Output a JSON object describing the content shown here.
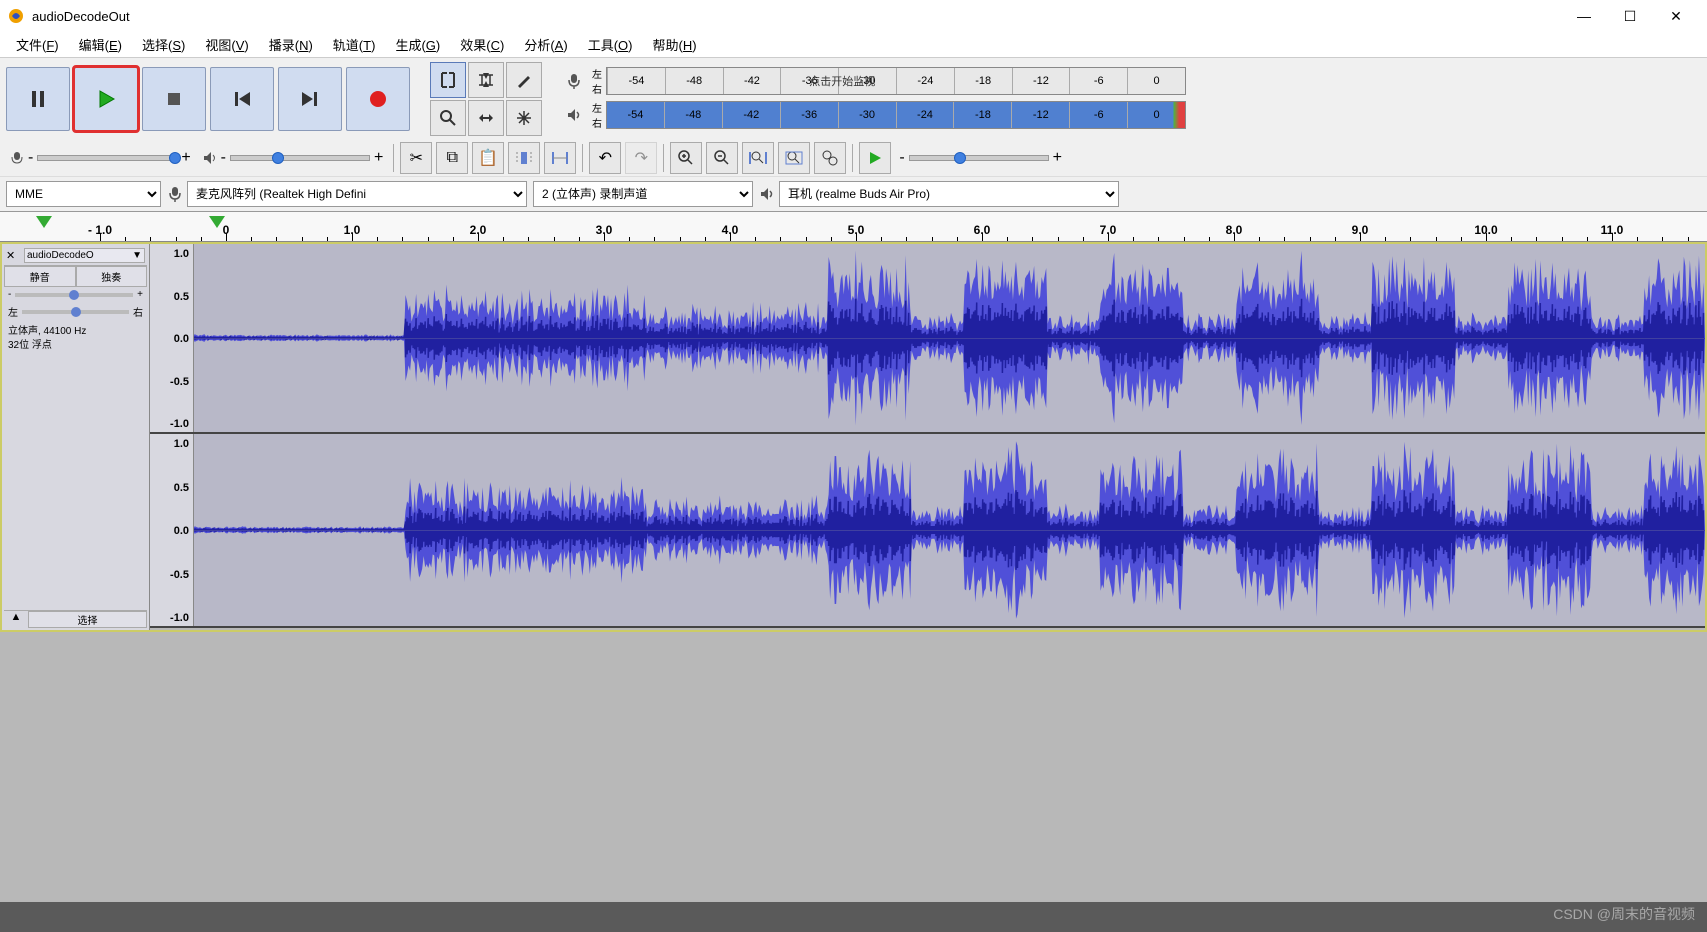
{
  "window": {
    "title": "audioDecodeOut"
  },
  "menu": {
    "items": [
      {
        "label": "文件",
        "accel": "F"
      },
      {
        "label": "编辑",
        "accel": "E"
      },
      {
        "label": "选择",
        "accel": "S"
      },
      {
        "label": "视图",
        "accel": "V"
      },
      {
        "label": "播录",
        "accel": "N"
      },
      {
        "label": "轨道",
        "accel": "T"
      },
      {
        "label": "生成",
        "accel": "G"
      },
      {
        "label": "效果",
        "accel": "C"
      },
      {
        "label": "分析",
        "accel": "A"
      },
      {
        "label": "工具",
        "accel": "O"
      },
      {
        "label": "帮助",
        "accel": "H"
      }
    ]
  },
  "meters": {
    "record_hint": "点击开始监视",
    "channel_left": "左",
    "channel_right": "右",
    "ticks": [
      "-54",
      "-48",
      "-42",
      "-36",
      "-30",
      "-24",
      "-18",
      "-12",
      "-6",
      "0"
    ]
  },
  "devices": {
    "host": "MME",
    "input": "麦克风阵列 (Realtek High Defini",
    "channels": "2 (立体声) 录制声道",
    "output": "耳机 (realme Buds Air Pro)"
  },
  "timeline": {
    "ticks": [
      "- 1.0",
      "0",
      "1.0",
      "2.0",
      "3.0",
      "4.0",
      "5.0",
      "6.0",
      "7.0",
      "8.0",
      "9.0",
      "10.0",
      "11.0"
    ]
  },
  "track": {
    "name": "audioDecodeO",
    "mute": "静音",
    "solo": "独奏",
    "gain_minus": "-",
    "gain_plus": "+",
    "pan_left": "左",
    "pan_right": "右",
    "info_line1": "立体声, 44100 Hz",
    "info_line2": "32位 浮点",
    "select_btn": "选择"
  },
  "wave_scale": {
    "labels": [
      "1.0",
      "0.5",
      "0.0",
      "-0.5",
      "-1.0"
    ]
  },
  "watermark": "CSDN @周末的音视频"
}
